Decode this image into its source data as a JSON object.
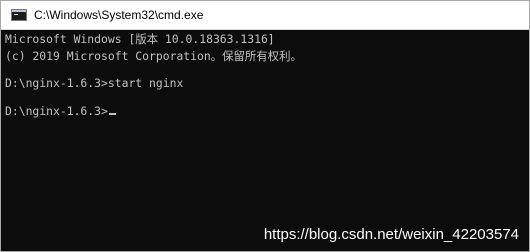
{
  "window": {
    "title": "C:\\Windows\\System32\\cmd.exe"
  },
  "console": {
    "lines": [
      "Microsoft Windows [版本 10.0.18363.1316]",
      "(c) 2019 Microsoft Corporation。保留所有权利。",
      "",
      "D:\\nginx-1.6.3>start nginx",
      "",
      "D:\\nginx-1.6.3>"
    ],
    "text_color": "#c0c0c0",
    "background_color": "#0c0c0c"
  },
  "watermark": {
    "text": "https://blog.csdn.net/weixin_42203574"
  }
}
